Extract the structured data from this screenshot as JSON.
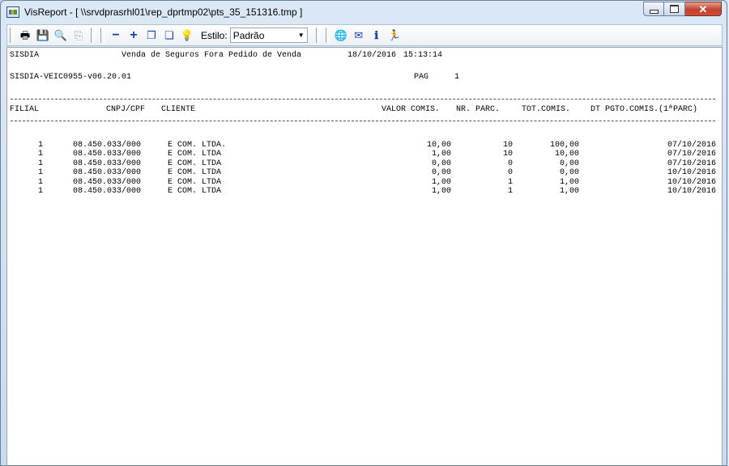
{
  "window": {
    "title": "VisReport - [ \\\\srvdprasrhl01\\rep_dprtmp02\\pts_35_151316.tmp ]",
    "minimize_glyph": "",
    "maximize_glyph": "",
    "close_glyph": "✕"
  },
  "toolbar": {
    "buttons": [
      {
        "name": "print-icon",
        "glyph": "🖶"
      },
      {
        "name": "save-icon",
        "glyph": "💾"
      },
      {
        "name": "search-icon",
        "glyph": "🔍"
      },
      {
        "name": "export-icon",
        "glyph": "⎘"
      },
      {
        "name": "zoom-out-icon",
        "glyph": "−"
      },
      {
        "name": "zoom-in-icon",
        "glyph": "+"
      },
      {
        "name": "copy-icon",
        "glyph": "❐"
      },
      {
        "name": "copy-all-icon",
        "glyph": "❏"
      },
      {
        "name": "style-bulb-icon",
        "glyph": "💡"
      }
    ],
    "estilo_label": "Estilo:",
    "estilo_value": "Padrão",
    "right_buttons": [
      {
        "name": "globe-icon",
        "glyph": "🌐"
      },
      {
        "name": "mail-icon",
        "glyph": "✉"
      },
      {
        "name": "info-icon",
        "glyph": "ℹ"
      },
      {
        "name": "exit-icon",
        "glyph": "🏃"
      }
    ],
    "colors": {
      "zoom": "#1a3fb3",
      "bulb": "#e6b800",
      "globe": "#2f8fd8",
      "exit": "#2a9a2a"
    }
  },
  "report": {
    "system": "SISDIA",
    "title": "Venda de Seguros Fora Pedido de Venda",
    "date": "18/10/2016",
    "time": "15:13:14",
    "program": "SISDIA-VEIC0955-v06.20.01",
    "page_label": "PAG",
    "page_number": "1",
    "columns": {
      "filial": "FILIAL",
      "cnpj": "CNPJ/CPF",
      "cliente": "CLIENTE",
      "valor": "VALOR COMIS.",
      "nr_parc": "NR. PARC.",
      "tot": "TOT.COMIS.",
      "dt": "DT PGTO.COMIS.(1ªPARC)"
    },
    "rows": [
      {
        "filial": "1",
        "cnpj": "08.450.033/000",
        "cliente": "E COM. LTDA.",
        "valor": "10,00",
        "nr_parc": "10",
        "tot": "100,00",
        "dt": "07/10/2016"
      },
      {
        "filial": "1",
        "cnpj": "08.450.033/000",
        "cliente": "E COM. LTDA",
        "valor": "1,00",
        "nr_parc": "10",
        "tot": "10,00",
        "dt": "07/10/2016"
      },
      {
        "filial": "1",
        "cnpj": "08.450.033/000",
        "cliente": "E COM. LTDA",
        "valor": "0,00",
        "nr_parc": "0",
        "tot": "0,00",
        "dt": "07/10/2016"
      },
      {
        "filial": "1",
        "cnpj": "08.450.033/000",
        "cliente": "E COM. LTDA",
        "valor": "0,00",
        "nr_parc": "0",
        "tot": "0,00",
        "dt": "10/10/2016"
      },
      {
        "filial": "1",
        "cnpj": "08.450.033/000",
        "cliente": "E COM. LTDA",
        "valor": "1,00",
        "nr_parc": "1",
        "tot": "1,00",
        "dt": "10/10/2016"
      },
      {
        "filial": "1",
        "cnpj": "08.450.033/000",
        "cliente": "E COM. LTDA",
        "valor": "1,00",
        "nr_parc": "1",
        "tot": "1,00",
        "dt": "10/10/2016"
      }
    ]
  }
}
